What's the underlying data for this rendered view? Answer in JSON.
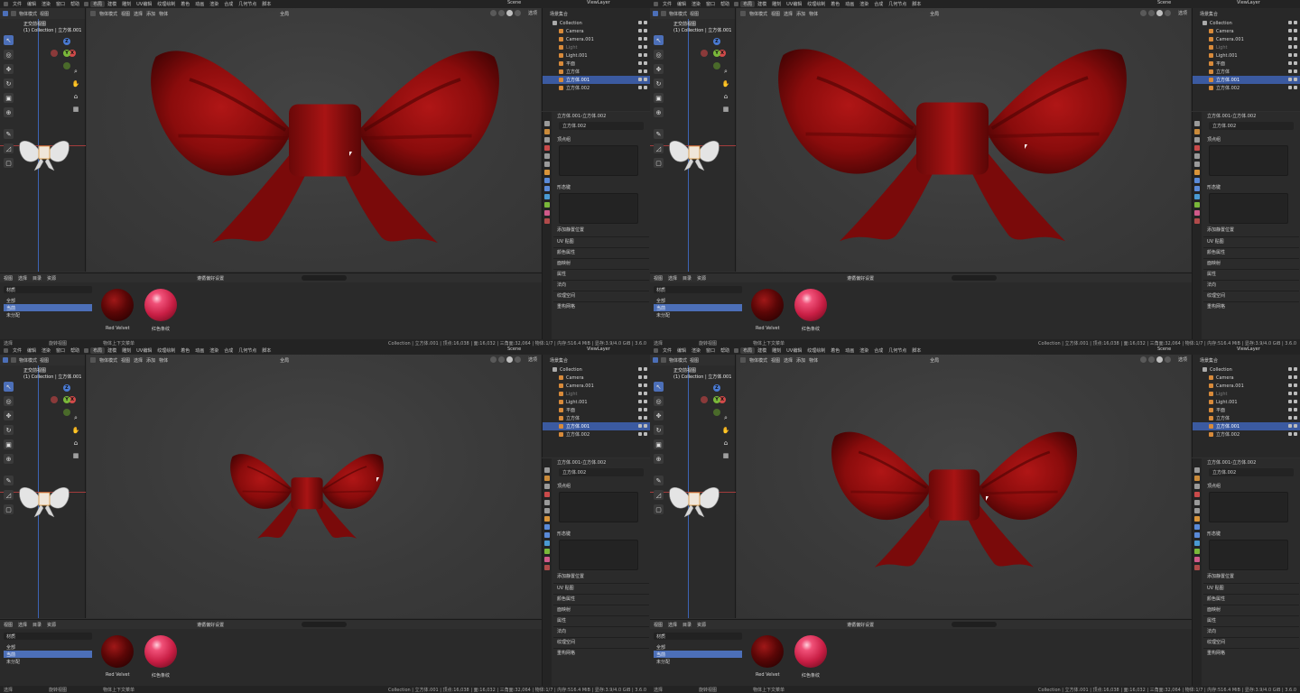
{
  "menu": {
    "items": [
      "文件",
      "编辑",
      "渲染",
      "窗口",
      "帮助",
      "布局",
      "建模",
      "雕刻",
      "UV编辑",
      "纹理绘制",
      "着色",
      "动画",
      "渲染",
      "合成",
      "几何节点",
      "脚本"
    ],
    "active_index": 5,
    "scene": "Scene",
    "view_layer": "ViewLayer"
  },
  "left_panel": {
    "mode": "物体模式",
    "menus": [
      "视图",
      "选择",
      "添加",
      "物体"
    ],
    "overlay_view": "正交前视图",
    "overlay_collection": "(1) Collection | 立方体.001"
  },
  "viewport": {
    "transform": "全局",
    "options": "选项"
  },
  "outliner": {
    "title": "场景集合",
    "rows": [
      {
        "label": "Collection",
        "color": "#d8d8d8",
        "icon_color": "#aaa",
        "indent": 1,
        "selected": false
      },
      {
        "label": "Camera",
        "color": "#d2d2d2",
        "icon_color": "#d88a3a",
        "indent": 2,
        "selected": false
      },
      {
        "label": "Camera.001",
        "color": "#d2d2d2",
        "icon_color": "#d88a3a",
        "indent": 2,
        "selected": false
      },
      {
        "label": "Light",
        "color": "#7a7a7a",
        "icon_color": "#d88a3a",
        "indent": 2,
        "selected": false
      },
      {
        "label": "Light.001",
        "color": "#d2d2d2",
        "icon_color": "#d88a3a",
        "indent": 2,
        "selected": false
      },
      {
        "label": "平面",
        "color": "#d2d2d2",
        "icon_color": "#d88a3a",
        "indent": 2,
        "selected": false
      },
      {
        "label": "立方体",
        "color": "#d2d2d2",
        "icon_color": "#d88a3a",
        "indent": 2,
        "selected": false
      },
      {
        "label": "立方体.001",
        "color": "#ffffff",
        "icon_color": "#d88a3a",
        "indent": 2,
        "selected": true
      },
      {
        "label": "立方体.002",
        "color": "#d2d2d2",
        "icon_color": "#d88a3a",
        "indent": 2,
        "selected": false
      }
    ]
  },
  "properties": {
    "breadcrumb_a": "立方体.001",
    "breadcrumb_b": "立方体.002",
    "mesh_name": "立方体.002",
    "section_vertex_groups": "顶点组",
    "section_shape_keys": "形态键",
    "add_rest_position": "添加静置位置",
    "sections": [
      "UV 贴图",
      "颜色属性",
      "面映射",
      "属性",
      "法向",
      "纹理空间",
      "重构网格"
    ]
  },
  "materials": {
    "menus": [
      "视图",
      "选择",
      "目录",
      "资源"
    ],
    "catalog_setting": "遵循偏好设置",
    "list_title": "材质",
    "list_items": [
      {
        "label": "全部",
        "selected": false
      },
      {
        "label": "当前",
        "selected": true
      },
      {
        "label": "未分配",
        "selected": false
      }
    ],
    "thumbs": [
      {
        "label": "Red Velvet",
        "kind": "velvet"
      },
      {
        "label": "红色条纹",
        "kind": "pink"
      }
    ]
  },
  "status": {
    "left_items": [
      "选择",
      "旋转视图",
      "物体上下文菜单"
    ],
    "right": "Collection | 立方体.001 | 顶点:16,038 | 面:16,032 | 三角面:32,064 | 物体:1/7 | 内存:516.4 MiB | 显存:3.9/4.0 GiB | 3.6.0"
  }
}
